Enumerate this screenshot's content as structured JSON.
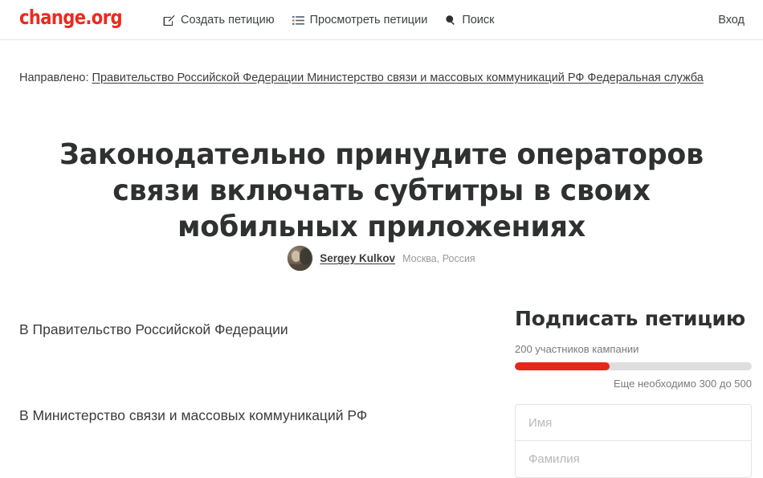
{
  "header": {
    "logo": "change.org",
    "nav": [
      {
        "icon": "pencil-square-icon",
        "label": "Создать петицию"
      },
      {
        "icon": "list-icon",
        "label": "Просмотреть петиции"
      },
      {
        "icon": "search-icon",
        "label": "Поиск"
      }
    ],
    "login_label": "Вход"
  },
  "petition": {
    "target_label": "Направлено:",
    "target_link": "Правительство Российской Федерации Министерство связи и массовых коммуникаций РФ Федеральная служба",
    "title": "Законодательно принудите операторов связи включать субтитры в своих мобильных приложениях",
    "author_name": "Sergey Kulkov",
    "author_location": "Москва, Россия",
    "body_paragraphs": [
      "В Правительство Российской Федерации",
      "В Министерство связи и массовых коммуникаций РФ"
    ]
  },
  "sign_panel": {
    "title": "Подписать петицию",
    "supporters_text": "200 участников кампании",
    "progress_percent": 40,
    "goal_text": "Еще необходимо 300 до 500",
    "fields": [
      {
        "name": "first-name",
        "placeholder": "Имя",
        "value": ""
      },
      {
        "name": "last-name",
        "placeholder": "Фамилия",
        "value": ""
      }
    ]
  },
  "colors": {
    "brand_red": "#ed2a1e",
    "progress_red": "#e8251b",
    "progress_track": "#dedede",
    "text": "#3c3c3c",
    "muted": "#7b7b7b"
  }
}
